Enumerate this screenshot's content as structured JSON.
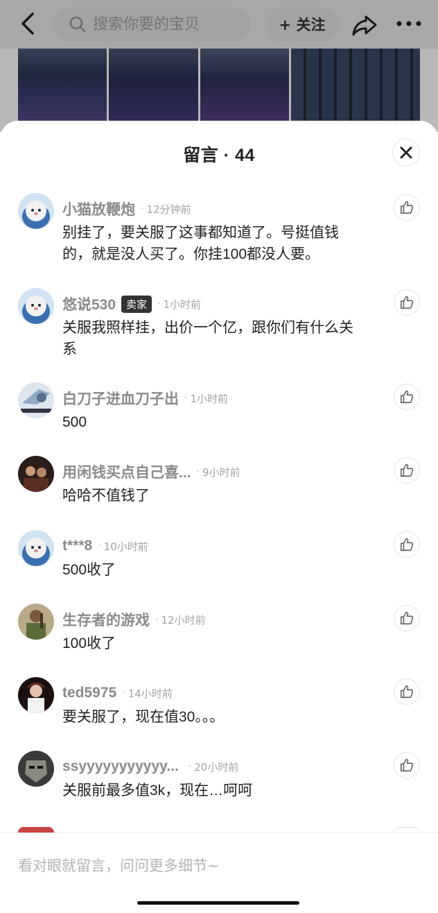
{
  "topbar": {
    "search_placeholder": "搜索你要的宝贝",
    "follow_label": "+ 关注"
  },
  "sheet": {
    "title": "留言 · 44"
  },
  "comments": [
    {
      "name": "小猫放鞭炮",
      "badge": "",
      "time": "12分钟前",
      "text": "别挂了，要关服了这事都知道了。号挺值钱的，就是没人买了。你挂100都没人要。"
    },
    {
      "name": "悠说530",
      "badge": "卖家",
      "time": "1小时前",
      "text": "关服我照样挂，出价一个亿，跟你们有什么关系"
    },
    {
      "name": "白刀子进血刀子出",
      "badge": "",
      "time": "1小时前",
      "text": "500"
    },
    {
      "name": "用闲钱买点自己喜...",
      "badge": "",
      "time": "9小时前",
      "text": "哈哈不值钱了"
    },
    {
      "name": "t***8",
      "badge": "",
      "time": "10小时前",
      "text": "500收了"
    },
    {
      "name": "生存者的游戏",
      "badge": "",
      "time": "12小时前",
      "text": "100收了"
    },
    {
      "name": "ted5975",
      "badge": "",
      "time": "14小时前",
      "text": "要关服了，现在值30。。。"
    },
    {
      "name": "ssyyyyyyyyyyy...",
      "badge": "",
      "time": "20小时前",
      "text": "关服前最多值3k，现在…呵呵"
    }
  ],
  "input": {
    "placeholder": "看对眼就留言，问问更多细节~"
  },
  "icons": {
    "back": "chevron-left-icon",
    "search": "search-icon",
    "share": "share-icon",
    "more": "more-icon",
    "close": "close-icon",
    "like": "thumbs-up-icon"
  }
}
